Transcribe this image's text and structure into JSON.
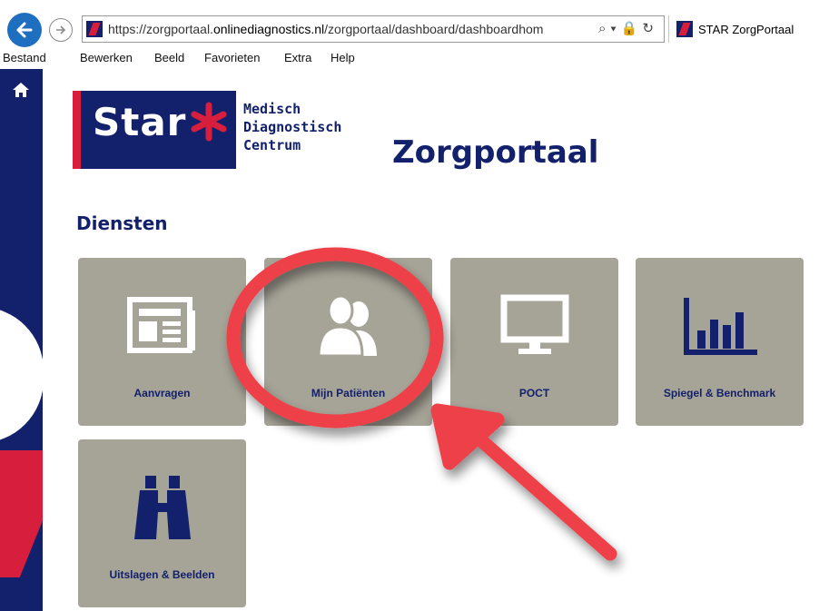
{
  "browser": {
    "url": "https://zorgportaal.onlinediagnostics.nl/zorgportaal/dashboard/dashboardhom",
    "url_domain": "onlinediagnostics.nl",
    "tab_title": "STAR ZorgPortaal"
  },
  "menu": [
    "Bestand",
    "Bewerken",
    "Beeld",
    "Favorieten",
    "Extra",
    "Help"
  ],
  "logo": {
    "word": "Star",
    "sub": [
      "Medisch",
      "Diagnostisch",
      "Centrum"
    ]
  },
  "page_title": "Zorgportaal",
  "section_title": "Diensten",
  "tiles": [
    {
      "label": "Aanvragen",
      "icon": "newspaper-icon"
    },
    {
      "label": "Mijn Patiënten",
      "icon": "users-icon"
    },
    {
      "label": "POCT",
      "icon": "monitor-icon"
    },
    {
      "label": "Spiegel & Benchmark",
      "icon": "bar-chart-icon"
    },
    {
      "label": "Uitslagen & Beelden",
      "icon": "binoculars-icon"
    }
  ],
  "colors": {
    "brand_navy": "#13206b",
    "brand_red": "#d81e3d",
    "tile_gray": "#a6a397",
    "annotation_red": "#ee4048"
  }
}
